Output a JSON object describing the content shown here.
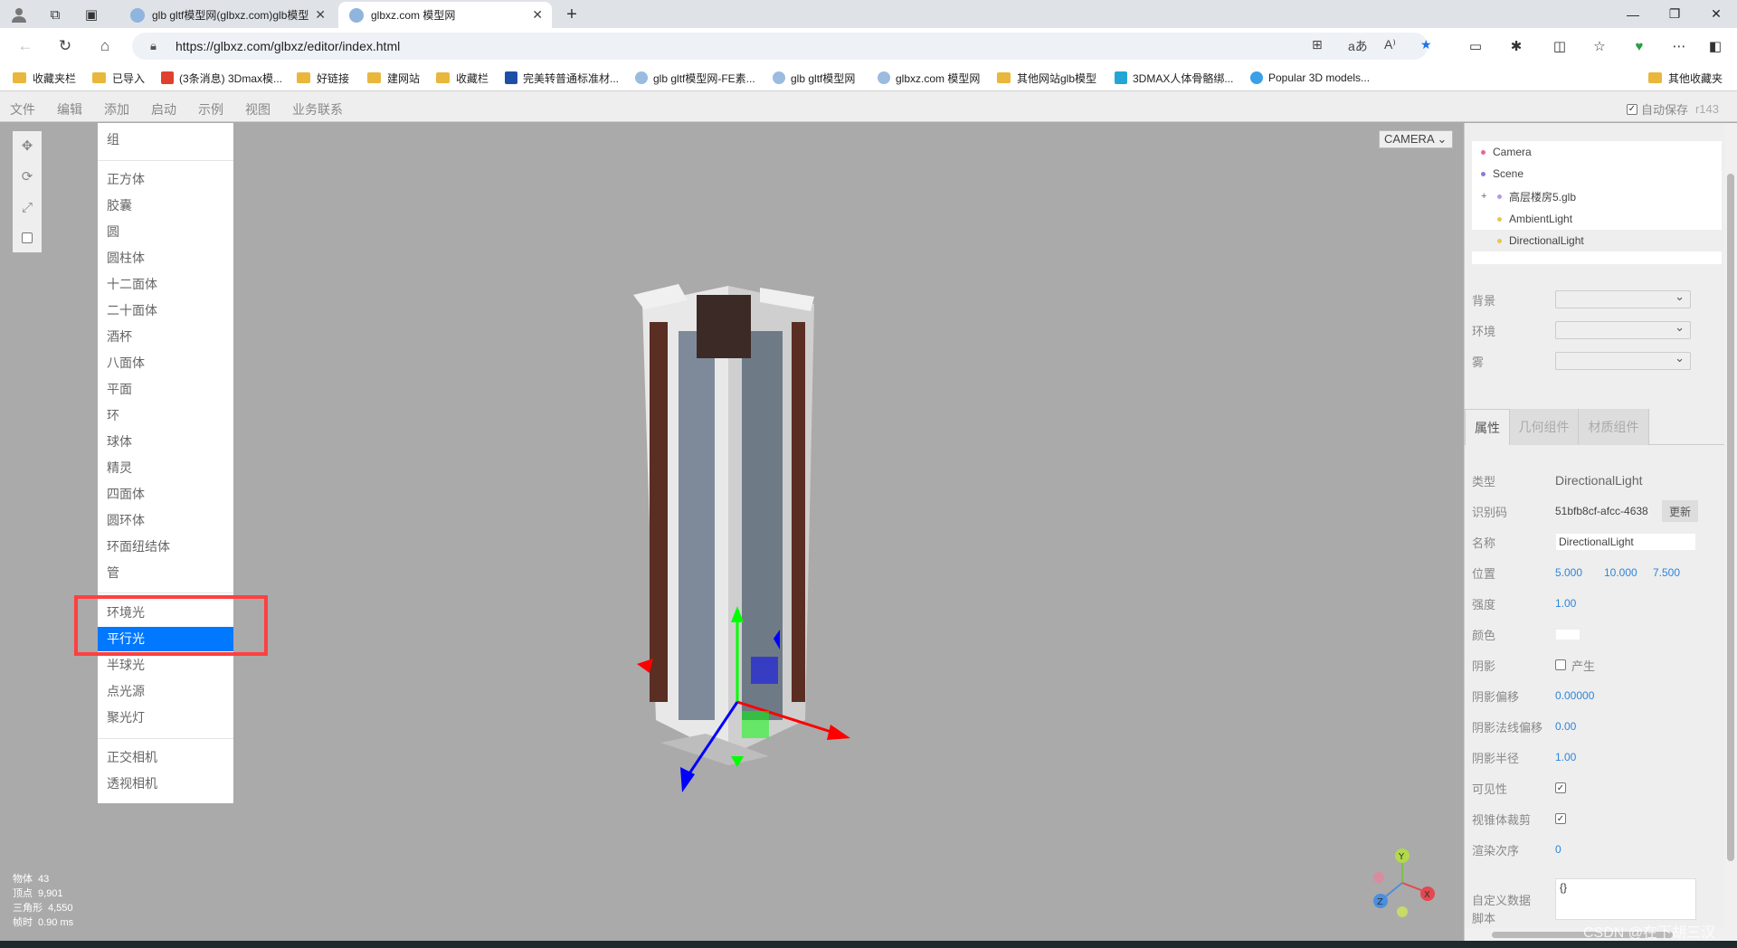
{
  "browser": {
    "tabs": [
      {
        "title": "glb gltf模型网(glbxz.com)glb模型"
      },
      {
        "title": "glbxz.com 模型网"
      }
    ],
    "url": "https://glbxz.com/glbxz/editor/index.html",
    "bookmarks": [
      "收藏夹栏",
      "已导入",
      "(3条消息) 3Dmax模...",
      "好链接",
      "建网站",
      "收藏栏",
      "完美转普通标准材...",
      "glb gltf模型网-FE素...",
      "glb gltf模型网",
      "glbxz.com 模型网",
      "其他网站glb模型",
      "3DMAX人体骨骼绑...",
      "Popular 3D models...",
      "其他收藏夹"
    ]
  },
  "editor": {
    "menu": [
      "文件",
      "编辑",
      "添加",
      "启动",
      "示例",
      "视图",
      "业务联系"
    ],
    "autosave_label": "自动保存",
    "revision": "r143",
    "camera_select": "CAMERA",
    "add_menu": {
      "group1": [
        "组"
      ],
      "group2": [
        "正方体",
        "胶囊",
        "圆",
        "圆柱体",
        "十二面体",
        "二十面体",
        "酒杯",
        "八面体",
        "平面",
        "环",
        "球体",
        "精灵",
        "四面体",
        "圆环体",
        "环面纽结体",
        "管"
      ],
      "group3": [
        "环境光",
        "平行光",
        "半球光",
        "点光源",
        "聚光灯"
      ],
      "group4": [
        "正交相机",
        "透视相机"
      ],
      "active": "平行光"
    },
    "stats": {
      "objects_label": "物体",
      "objects": "43",
      "vertices_label": "顶点",
      "vertices": "9,901",
      "triangles_label": "三角形",
      "triangles": "4,550",
      "frametime_label": "帧时",
      "frametime": "0.90 ms"
    },
    "outliner": [
      {
        "label": "Camera",
        "color": "#e06b8b"
      },
      {
        "label": "Scene",
        "color": "#8b7bd6"
      },
      {
        "label": "高层楼房5.glb",
        "color": "#b59ae0"
      },
      {
        "label": "AmbientLight",
        "color": "#e6c84a"
      },
      {
        "label": "DirectionalLight",
        "color": "#e6c84a"
      }
    ],
    "scene_props": {
      "background": "背景",
      "environment": "环境",
      "fog": "雾"
    },
    "panel_tabs": [
      "属性",
      "几何组件",
      "材质组件"
    ],
    "props": {
      "type_label": "类型",
      "type": "DirectionalLight",
      "uuid_label": "识别码",
      "uuid": "51bfb8cf-afcc-4638",
      "update_label": "更新",
      "name_label": "名称",
      "name": "DirectionalLight",
      "position_label": "位置",
      "pos_x": "5.000",
      "pos_y": "10.000",
      "pos_z": "7.500",
      "intensity_label": "强度",
      "intensity": "1.00",
      "color_label": "颜色",
      "shadow_label": "阴影",
      "shadow_cast": "产生",
      "shadow_bias_label": "阴影偏移",
      "shadow_bias": "0.00000",
      "shadow_normal_label": "阴影法线偏移",
      "shadow_normal": "0.00",
      "shadow_radius_label": "阴影半径",
      "shadow_radius": "1.00",
      "visible_label": "可见性",
      "frustum_label": "视锥体裁剪",
      "render_order_label": "渲染次序",
      "render_order": "0",
      "userdata_label": "自定义数据",
      "userdata": "{}",
      "script_label": "脚本"
    },
    "watermark": "CSDN @在下胡三汉"
  }
}
